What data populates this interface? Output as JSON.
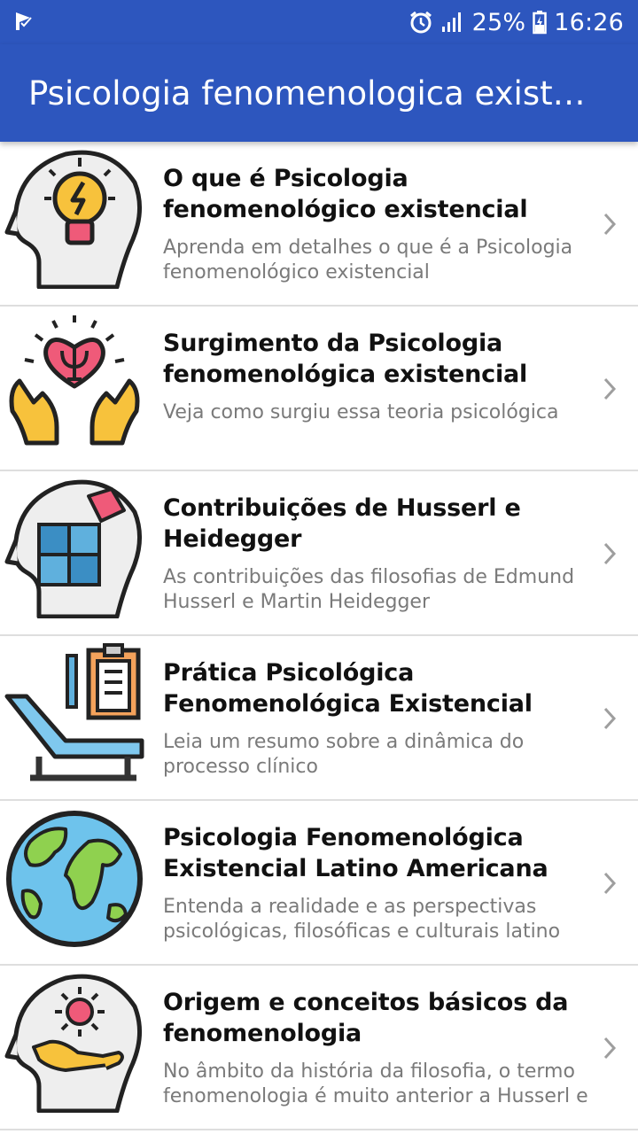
{
  "status_bar": {
    "notification_icon": "check-flag-icon",
    "alarm_icon": "alarm-clock-icon",
    "signal_icon": "signal-bars-icon",
    "battery_percent": "25%",
    "battery_icon": "battery-charging-icon",
    "time": "16:26"
  },
  "app_bar": {
    "title": "Psicologia fenomenologica existencial",
    "background_color": "#2d56be"
  },
  "items": [
    {
      "title": "O que é Psicologia fenomenológico existencial",
      "description": "Aprenda em detalhes o que é a Psicologia fenomenológico existencial",
      "icon": "head-lightbulb-icon"
    },
    {
      "title": "Surgimento da Psicologia fenomenológica existencial",
      "description": "Veja como surgiu essa teoria psicológica",
      "icon": "hands-heart-psi-icon"
    },
    {
      "title": "Contribuições de Husserl e Heidegger",
      "description": "As contribuições das filosofias de Edmund Husserl e Martin Heidegger",
      "icon": "head-puzzle-icon"
    },
    {
      "title": "Prática Psicológica Fenomenológica Existencial",
      "description": "Leia um resumo sobre a dinâmica do processo clínico",
      "icon": "therapy-couch-clipboard-icon"
    },
    {
      "title": "Psicologia Fenomenológica Existencial Latino Americana",
      "description": "Entenda a realidade e as perspectivas psicológicas, filosóficas e culturais latino",
      "icon": "globe-icon"
    },
    {
      "title": "Origem e conceitos básicos da fenomenologia",
      "description": "No âmbito da história da filosofia, o termo fenomenologia é muito anterior a Husserl e",
      "icon": "head-hand-sun-icon"
    }
  ]
}
